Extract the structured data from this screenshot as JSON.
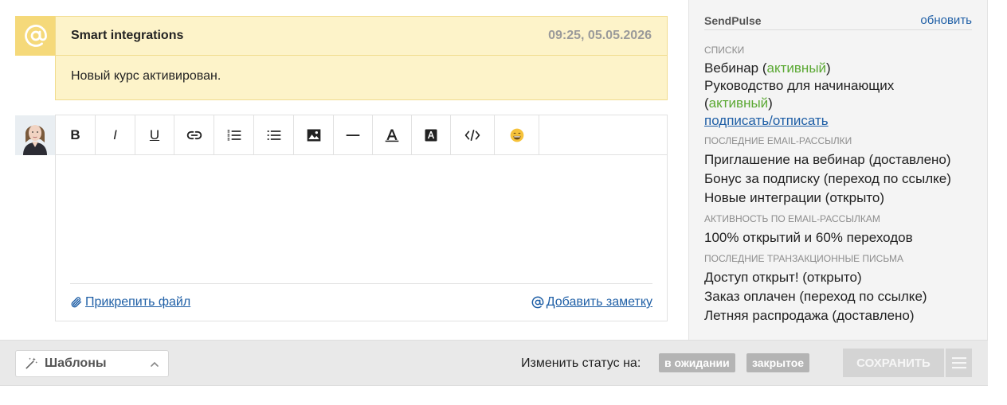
{
  "note": {
    "icon": "at-sign-icon",
    "title": "Smart integrations",
    "time": "09:25, 05.05.2026",
    "text": "Новый курс активирован.",
    "bg_color": "#fdf3c9",
    "icon_bg": "#f5d97a"
  },
  "editor": {
    "toolbar": [
      {
        "name": "bold",
        "label": "B"
      },
      {
        "name": "italic",
        "label": "I"
      },
      {
        "name": "underline",
        "label": "U"
      },
      {
        "name": "link",
        "icon": "link-icon"
      },
      {
        "name": "ordered-list",
        "icon": "ordered-list-icon"
      },
      {
        "name": "bullet-list",
        "icon": "bullet-list-icon"
      },
      {
        "name": "image",
        "icon": "image-icon"
      },
      {
        "name": "horizontal-rule",
        "icon": "horizontal-rule-icon"
      },
      {
        "name": "text-color",
        "icon": "text-color-icon"
      },
      {
        "name": "background-color",
        "icon": "background-color-icon"
      },
      {
        "name": "code",
        "icon": "code-icon"
      },
      {
        "name": "emoji",
        "icon": "emoji-icon"
      }
    ],
    "attach_label": "Прикрепить файл",
    "note_label": "Добавить заметку"
  },
  "sidebar": {
    "title": "SendPulse",
    "refresh": "обновить",
    "lists_label": "СПИСКИ",
    "lists": [
      {
        "name": "Вебинар",
        "status": "активный"
      },
      {
        "name": "Руководство для начинающих",
        "status": "активный"
      }
    ],
    "subscribe_link": "подписать/отписать",
    "campaigns_label": "ПОСЛЕДНИЕ EMAIL-РАССЫЛКИ",
    "campaigns": [
      "Приглашение на вебинар (доставлено)",
      "Бонус за подписку (переход по ссылке)",
      "Новые интеграции (открыто)"
    ],
    "activity_label": "АКТИВНОСТЬ ПО EMAIL-РАССЫЛКАМ",
    "activity": "100% открытий и 60% переходов",
    "transactional_label": "ПОСЛЕДНИЕ ТРАНЗАКЦИОННЫЕ ПИСЬМА",
    "transactional": [
      "Доступ открыт! (открыто)",
      "Заказ оплачен (переход по ссылке)",
      "Летняя распродажа (доставлено)"
    ],
    "accent_green": "#5aa832",
    "link_color": "#1f5fa6"
  },
  "bottom": {
    "templates_label": "Шаблоны",
    "status_label": "Изменить статус на:",
    "status_pending": "в ожидании",
    "status_closed": "закрытое",
    "save_label": "СОХРАНИТЬ"
  }
}
